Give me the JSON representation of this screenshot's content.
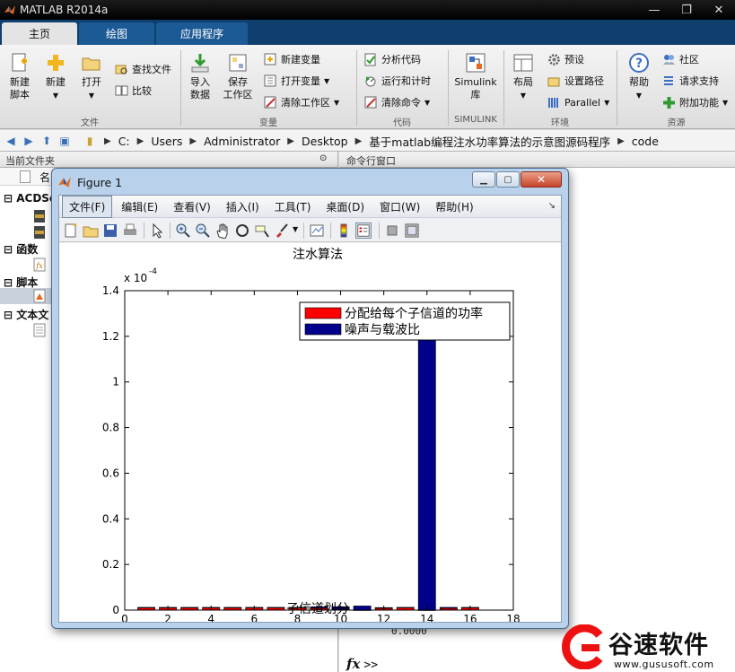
{
  "app": {
    "title": "MATLAB R2014a"
  },
  "ribbon_tabs": [
    {
      "label": "主页",
      "active": true
    },
    {
      "label": "绘图",
      "active": false
    },
    {
      "label": "应用程序",
      "active": false
    }
  ],
  "ribbon": {
    "file": {
      "new_script": "新建\n脚本",
      "new": "新建",
      "open": "打开",
      "find_files": "查找文件",
      "compare": "比较",
      "group": "文件"
    },
    "variable": {
      "import": "导入\n数据",
      "save_workspace": "保存\n工作区",
      "new_variable": "新建变量",
      "open_variable": "打开变量",
      "clear_workspace": "清除工作区",
      "group": "变量"
    },
    "code": {
      "analyze": "分析代码",
      "run_time": "运行和计时",
      "clear_commands": "清除命令",
      "group": "代码"
    },
    "simulink": {
      "library": "Simulink\n库",
      "group": "SIMULINK"
    },
    "environment": {
      "layout": "布局",
      "preferences": "预设",
      "set_path": "设置路径",
      "parallel": "Parallel",
      "group": "环境"
    },
    "resources": {
      "help": "帮助",
      "community": "社区",
      "request_support": "请求支持",
      "addons": "附加功能",
      "group": "资源"
    }
  },
  "address": {
    "segments": [
      "C:",
      "Users",
      "Administrator",
      "Desktop",
      "基于matlab编程注水功率算法的示意图源码程序",
      "code"
    ]
  },
  "current_folder": {
    "title": "当前文件夹",
    "column_name": "名",
    "groups": [
      "ACDSe",
      "函数",
      "脚本",
      "文本文"
    ]
  },
  "command_window": {
    "title": "命令行窗口",
    "output_partial": "0.0000",
    "prompt": ">>",
    "fx": "fx"
  },
  "figure": {
    "title": "Figure 1",
    "menu": [
      "文件(F)",
      "编辑(E)",
      "查看(V)",
      "插入(I)",
      "工具(T)",
      "桌面(D)",
      "窗口(W)",
      "帮助(H)"
    ],
    "selected_menu": 0
  },
  "chart_data": {
    "type": "bar",
    "title": "注水算法",
    "xlabel": "子信道划分",
    "ylabel": "",
    "y_exponent_label": "x 10",
    "y_exponent": "-4",
    "xlim": [
      0,
      18
    ],
    "ylim": [
      0,
      1.4
    ],
    "xticks": [
      0,
      2,
      4,
      6,
      8,
      10,
      12,
      14,
      16,
      18
    ],
    "yticks": [
      0,
      0.2,
      0.4,
      0.6,
      0.8,
      1,
      1.2,
      1.4
    ],
    "legend_position": "top-right",
    "stacked": true,
    "categories": [
      1,
      2,
      3,
      4,
      5,
      6,
      7,
      8,
      9,
      10,
      11,
      12,
      13,
      14,
      15,
      16
    ],
    "series": [
      {
        "name": "分配给每个子信道的功率",
        "color": "#ff0000",
        "values": [
          0.01,
          0.01,
          0.01,
          0.01,
          0.01,
          0.01,
          0.01,
          0.01,
          0.008,
          0.004,
          0.0,
          0.008,
          0.01,
          0.0,
          0.008,
          0.01
        ]
      },
      {
        "name": "噪声与载波比",
        "color": "#00008b",
        "values": [
          0.002,
          0.002,
          0.002,
          0.002,
          0.002,
          0.002,
          0.002,
          0.002,
          0.006,
          0.011,
          0.018,
          0.003,
          0.002,
          1.195,
          0.004,
          0.002
        ]
      }
    ]
  },
  "watermark": {
    "name": "谷速软件",
    "url": "www.gususoft.com"
  }
}
